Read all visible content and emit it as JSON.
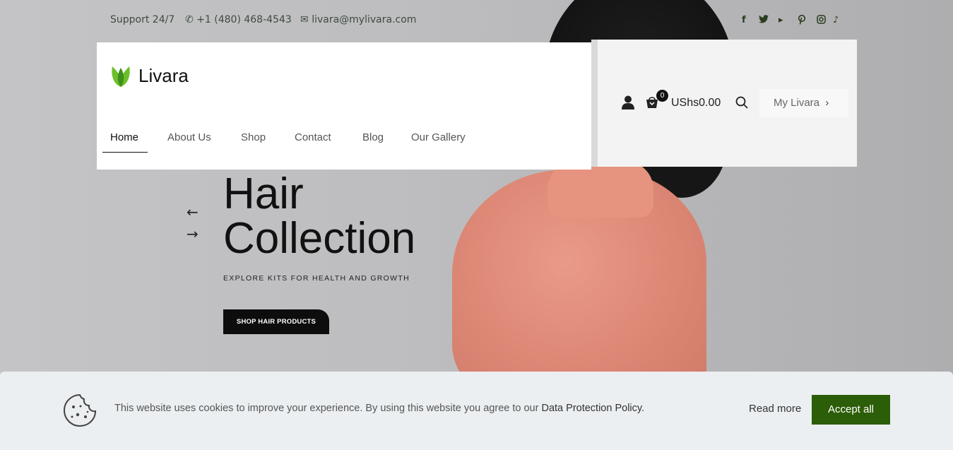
{
  "topbar": {
    "support": "Support 24/7",
    "phone": "+1 (480) 468-4543",
    "email": "livara@mylivara.com",
    "social": [
      "facebook-icon",
      "twitter-icon",
      "youtube-icon",
      "pinterest-icon",
      "instagram-icon",
      "tiktok-icon"
    ],
    "social_glyphs": [
      "f",
      "🐦",
      "▸",
      "𝓅",
      "◎",
      "♪"
    ]
  },
  "brand": {
    "name": "Livara",
    "color": "#6cbf2a"
  },
  "nav": {
    "items": [
      "Home",
      "About Us",
      "Shop",
      "Contact",
      "Blog",
      "Our Gallery"
    ],
    "active": "Home"
  },
  "header_right": {
    "cart_count": "0",
    "cart_total": "UShs0.00",
    "account_link": "My Livara"
  },
  "hero": {
    "title_line1": "Hair",
    "title_line2": "Collection",
    "subtitle": "EXPLORE KITS FOR HEALTH AND GROWTH",
    "cta": "SHOP HAIR PRODUCTS",
    "prev_arrow": "←",
    "next_arrow": "→"
  },
  "cookie": {
    "text": "This website uses cookies to improve your experience. By using this website you agree to our",
    "policy_link": "Data Protection Policy.",
    "read_more": "Read more",
    "accept": "Accept all",
    "accept_color": "#2c5d08"
  }
}
